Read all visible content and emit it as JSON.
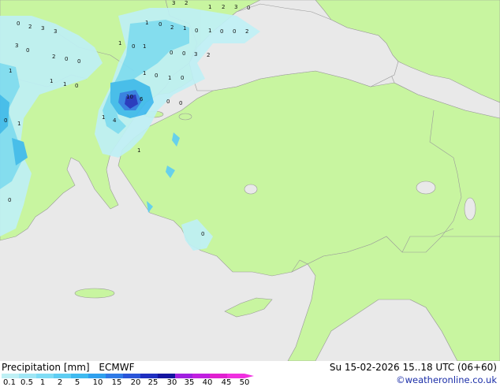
{
  "footer": {
    "left_label": "Precipitation [mm]",
    "model": "ECMWF",
    "valid_time": "Su 15-02-2026 15..18 UTC (06+60)",
    "credit": "©weatheronline.co.uk"
  },
  "legend": {
    "ticks": [
      "0.1",
      "0.5",
      "1",
      "2",
      "5",
      "10",
      "15",
      "20",
      "25",
      "30",
      "35",
      "40",
      "45",
      "50"
    ],
    "colors": [
      "#bff0f5",
      "#9fe6f5",
      "#7fdcf5",
      "#5fcdf2",
      "#3fbaf0",
      "#2fa0ee",
      "#2f7ae6",
      "#2a55d8",
      "#1f2fc0",
      "#1414a0",
      "#a020e0",
      "#c020e0",
      "#e020d0",
      "#f030e0"
    ]
  },
  "map": {
    "colors": {
      "sea": "#e9e9e9",
      "land": "#c8f5a0",
      "border": "#9a9a9a"
    },
    "precip_labels": [
      "3",
      "2",
      "1",
      "2",
      "3",
      "0",
      "0",
      "2",
      "3",
      "3",
      "1",
      "0",
      "2",
      "1",
      "0",
      "1",
      "0",
      "0",
      "2",
      "3",
      "0",
      "2",
      "0",
      "0",
      "1",
      "0",
      "1",
      "0",
      "0",
      "3",
      "2",
      "1",
      "1",
      "1",
      "0",
      "1",
      "0",
      "10",
      "6",
      "1",
      "0",
      "4",
      "1",
      "0",
      "1",
      "0",
      "0",
      "1",
      "0",
      "0"
    ]
  }
}
